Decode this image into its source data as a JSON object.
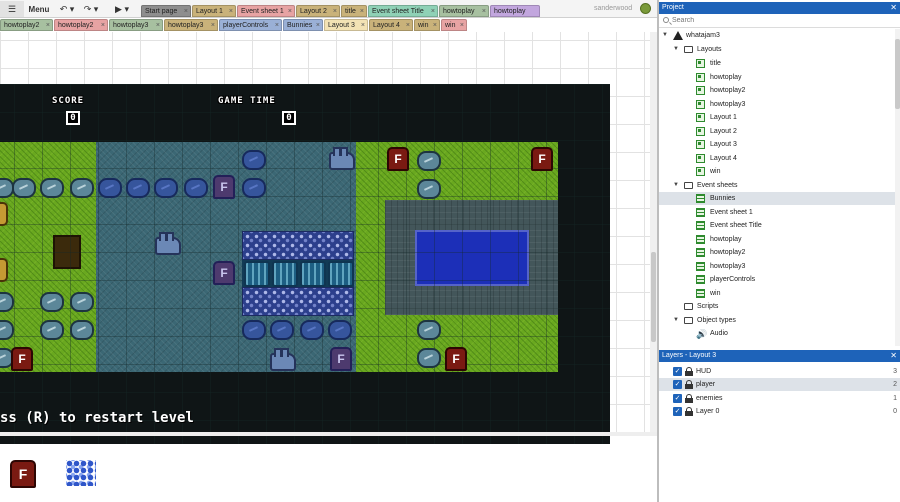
{
  "toolbar": {
    "menu_label": "Menu",
    "undo_icon": "undo-icon",
    "redo_icon": "redo-icon",
    "play_icon": "play-icon",
    "username": "sanderwood"
  },
  "tabs_row1": [
    {
      "label": "Start page",
      "color": "#8e8e8e"
    },
    {
      "label": "Layout 1",
      "color": "#c9b27a"
    },
    {
      "label": "Event sheet 1",
      "color": "#e7a3a3"
    },
    {
      "label": "Layout 2",
      "color": "#c9b27a"
    },
    {
      "label": "title",
      "color": "#c9b27a"
    },
    {
      "label": "Event sheet Title",
      "color": "#8fd1b6"
    },
    {
      "label": "howtoplay",
      "color": "#a7c0a0"
    },
    {
      "label": "howtoplay",
      "color": "#c2a6de"
    }
  ],
  "tabs_row2": [
    {
      "label": "howtoplay2",
      "color": "#a7c0a0"
    },
    {
      "label": "howtoplay2",
      "color": "#e7a3a3"
    },
    {
      "label": "howtoplay3",
      "color": "#a7c0a0"
    },
    {
      "label": "howtoplay3",
      "color": "#c9b27a"
    },
    {
      "label": "playerControls",
      "color": "#9ab0d6"
    },
    {
      "label": "Bunnies",
      "color": "#9ab0d6"
    },
    {
      "label": "Layout 3",
      "color": "#f3e2b4",
      "active": true
    },
    {
      "label": "Layout 4",
      "color": "#c9b27a"
    },
    {
      "label": "win",
      "color": "#c9b27a"
    },
    {
      "label": "win",
      "color": "#e7a3a3"
    }
  ],
  "hud": {
    "score_label": "SCORE",
    "score_value": "0",
    "time_label": "GAME TIME",
    "time_value": "0",
    "restart_text": "ss (R) to restart level"
  },
  "sprites": {
    "fblock_letter": "F"
  },
  "project_panel": {
    "title": "Project",
    "search_placeholder": "Search",
    "root": "whatajam3",
    "layouts_folder": "Layouts",
    "layouts": [
      "title",
      "howtoplay",
      "howtoplay2",
      "howtoplay3",
      "Layout 1",
      "Layout 2",
      "Layout 3",
      "Layout 4",
      "win"
    ],
    "event_sheets_folder": "Event sheets",
    "event_sheets": [
      "Bunnies",
      "Event sheet 1",
      "Event sheet Title",
      "howtoplay",
      "howtoplay2",
      "howtoplay3",
      "playerControls",
      "win"
    ],
    "scripts_folder": "Scripts",
    "object_types_folder": "Object types",
    "object_types": [
      "Audio"
    ]
  },
  "layers_panel": {
    "title": "Layers - Layout 3",
    "layers": [
      {
        "name": "HUD",
        "index": "3"
      },
      {
        "name": "player",
        "index": "2"
      },
      {
        "name": "enemies",
        "index": "1"
      },
      {
        "name": "Layer 0",
        "index": "0"
      }
    ]
  },
  "colors": {
    "accent": "#1e63b9",
    "grass": "#69a81f",
    "water": "#3b6774",
    "pond": "#1c2fb8"
  }
}
